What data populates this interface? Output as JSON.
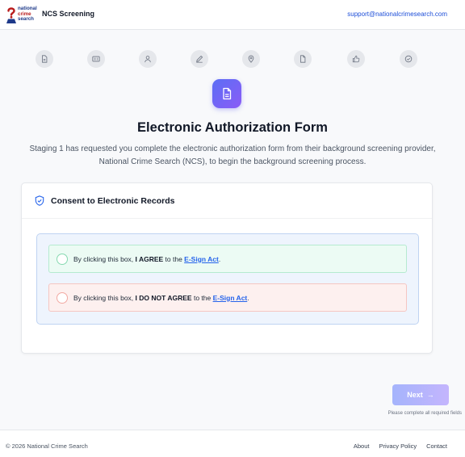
{
  "header": {
    "logo_lines": [
      "national",
      "crime",
      "search"
    ],
    "app_title": "NCS Screening",
    "support_email": "support@nationalcrimesearch.com"
  },
  "steps": [
    {
      "icon": "document-icon"
    },
    {
      "icon": "id-card-icon"
    },
    {
      "icon": "user-icon"
    },
    {
      "icon": "edit-icon"
    },
    {
      "icon": "location-pin-icon"
    },
    {
      "icon": "file-icon"
    },
    {
      "icon": "thumbs-up-icon"
    },
    {
      "icon": "check-circle-icon"
    }
  ],
  "main": {
    "title": "Electronic Authorization Form",
    "description": "Staging 1 has requested you complete the electronic authorization form from their background screening provider, National Crime Search (NCS), to begin the background screening process."
  },
  "consent": {
    "card_title": "Consent to Electronic Records",
    "agree": {
      "prefix": "By clicking this box, ",
      "bold": "I AGREE",
      "middle": " to the ",
      "link": "E-Sign Act",
      "suffix": "."
    },
    "disagree": {
      "prefix": "By clicking this box, ",
      "bold": "I DO NOT AGREE",
      "middle": " to the ",
      "link": "E-Sign Act",
      "suffix": "."
    }
  },
  "actions": {
    "next_label": "Next",
    "required_note": "Please complete all required fields"
  },
  "footer": {
    "copyright": "© 2026 National Crime Search",
    "links": [
      "About",
      "Privacy Policy",
      "Contact"
    ]
  },
  "colors": {
    "accent": "#6366f1",
    "link": "#2563eb",
    "agree_bg": "#ecfbf4",
    "disagree_bg": "#fdf0ef"
  }
}
